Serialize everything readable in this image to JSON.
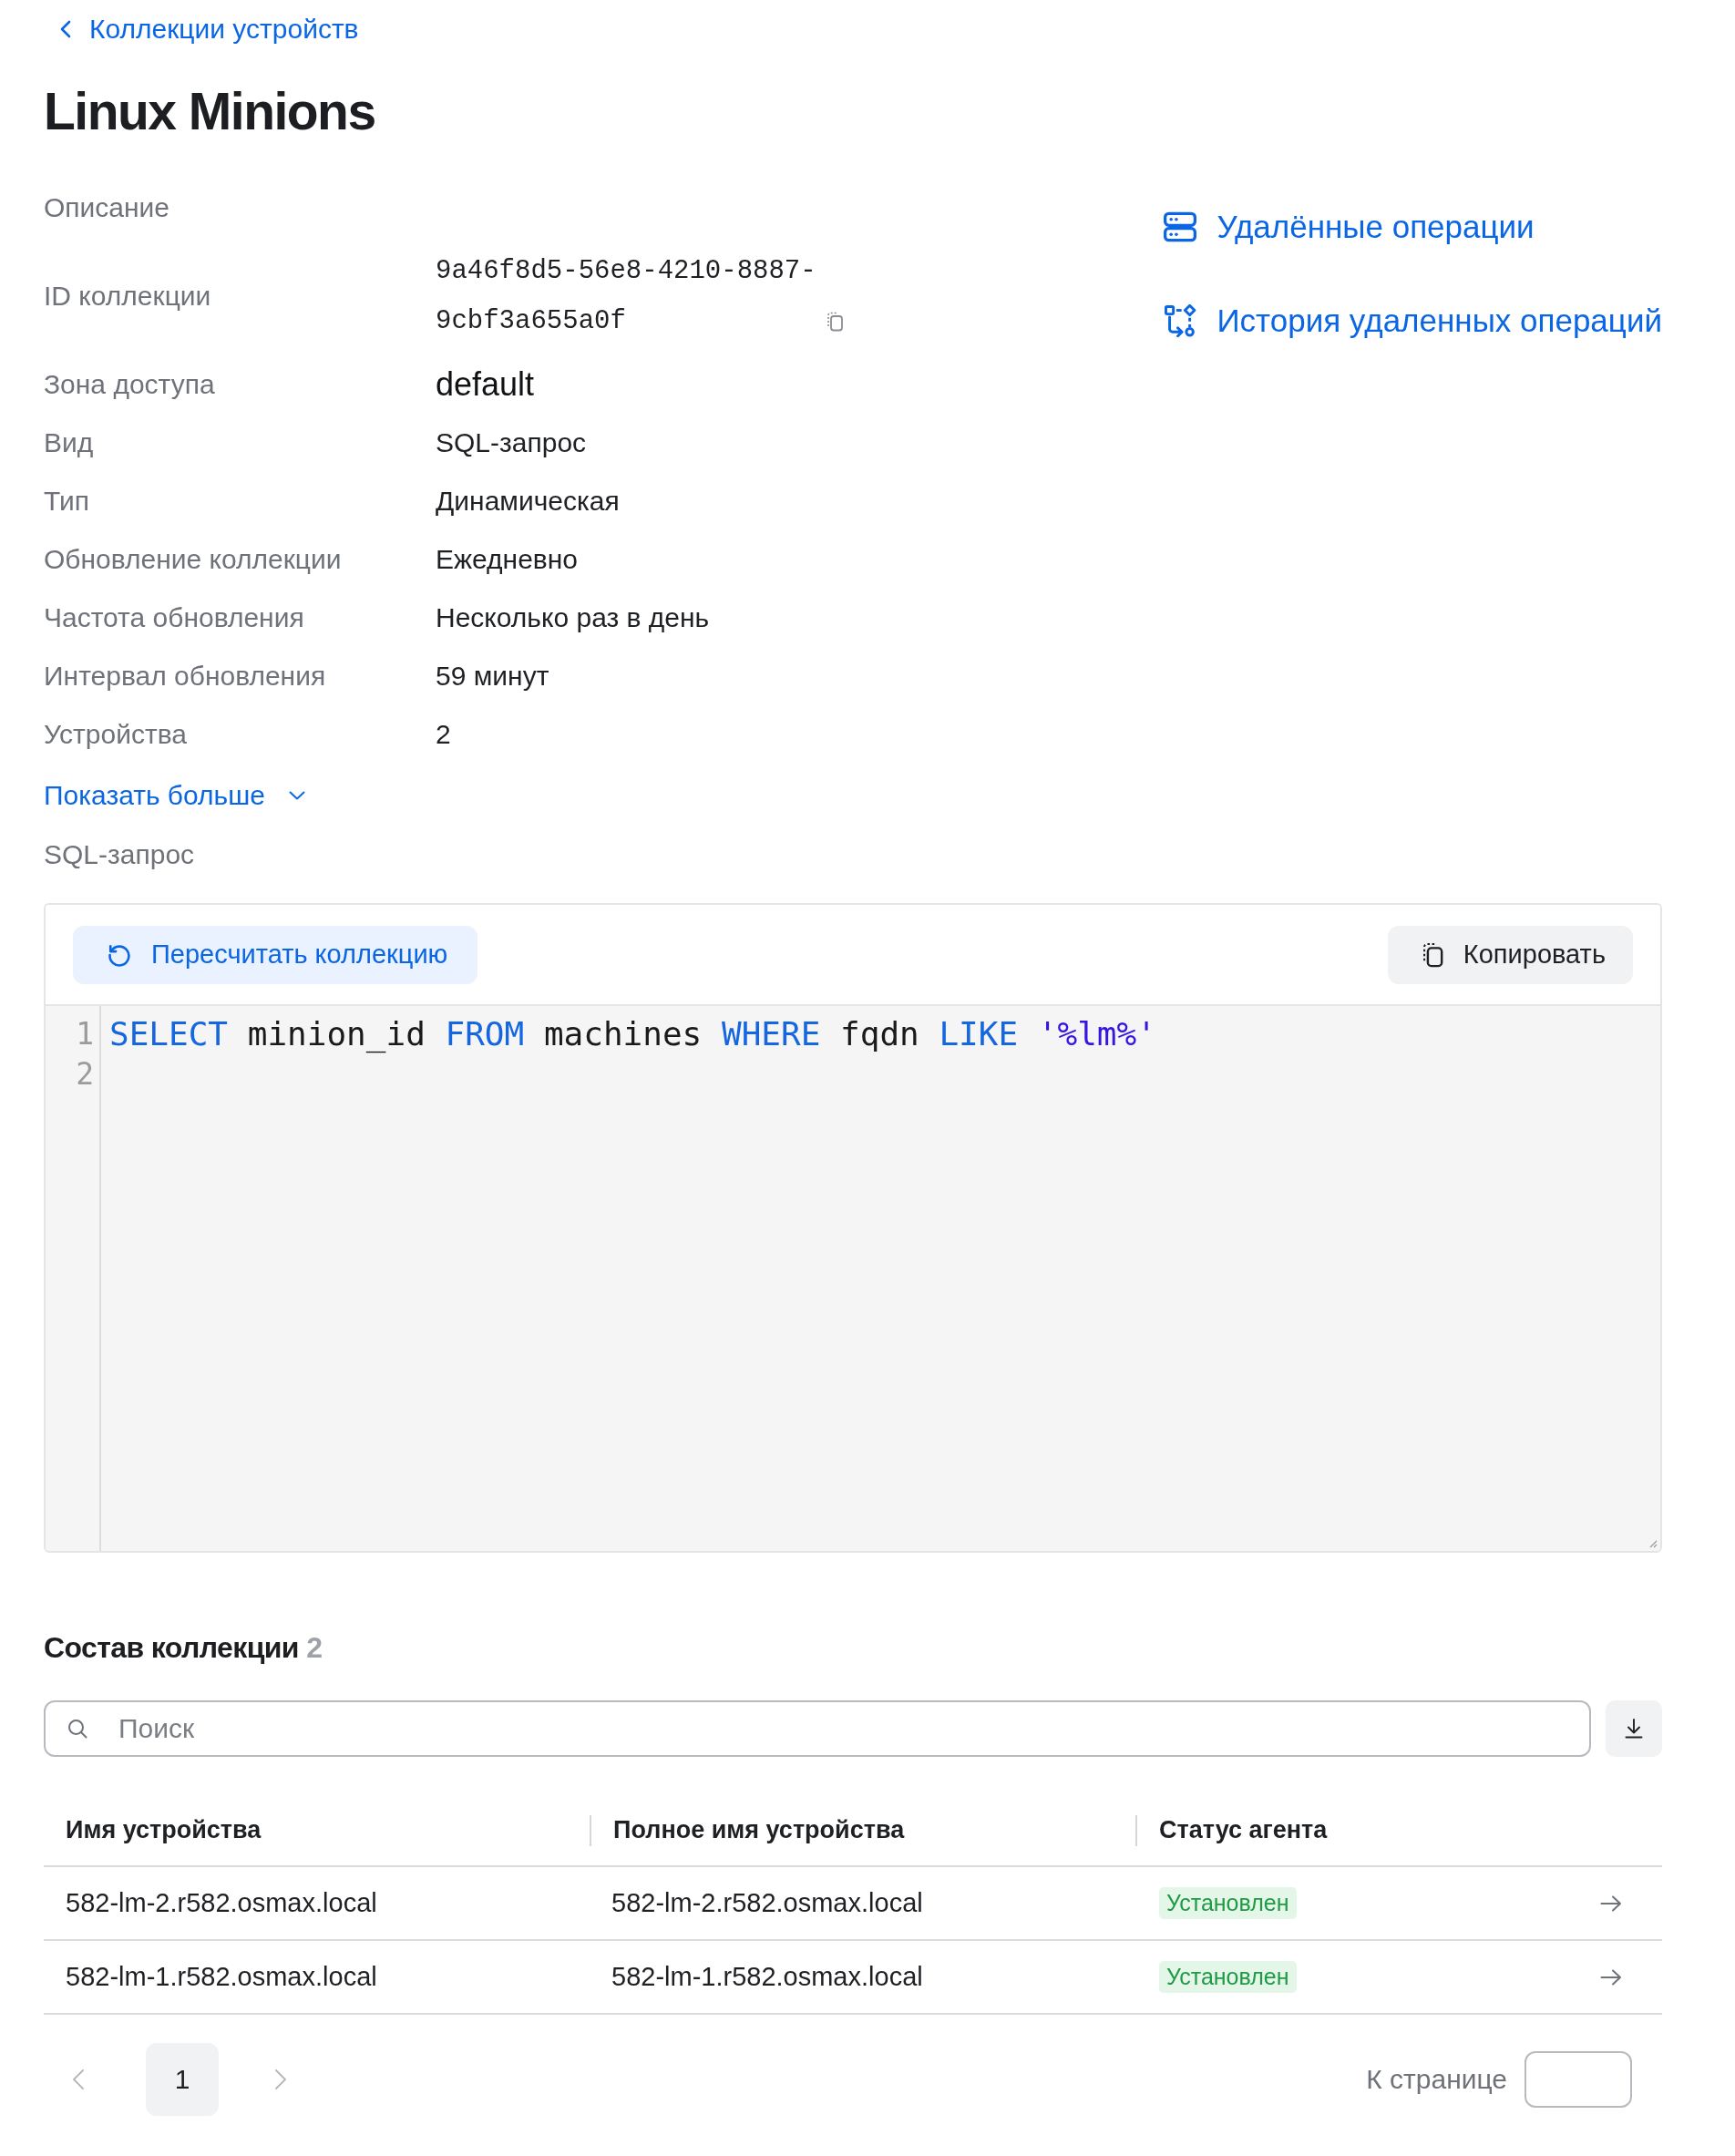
{
  "back_link": {
    "label": "Коллекции устройств"
  },
  "title": "Linux Minions",
  "details": [
    {
      "label": "Описание",
      "kind": "empty"
    },
    {
      "label": "ID коллекции",
      "value": "9a46f8d5-56e8-4210-8887-9cbf3a655a0f",
      "kind": "copyable"
    },
    {
      "label": "Зона доступа",
      "value": "default",
      "kind": "prominent"
    },
    {
      "label": "Вид",
      "value": "SQL-запрос",
      "kind": "text"
    },
    {
      "label": "Тип",
      "value": "Динамическая",
      "kind": "text"
    },
    {
      "label": "Обновление коллекции",
      "value": "Ежедневно",
      "kind": "text"
    },
    {
      "label": "Частота обновления",
      "value": "Несколько раз в день",
      "kind": "text"
    },
    {
      "label": "Интервал обновления",
      "value": "59 минут",
      "kind": "text"
    },
    {
      "label": "Устройства",
      "value": "2",
      "kind": "text"
    }
  ],
  "show_more": {
    "label": "Показать больше",
    "expanded": false
  },
  "query_label": "SQL-запрос",
  "side_links": [
    {
      "label": "Удалённые операции"
    },
    {
      "label": "История удаленных операций"
    }
  ],
  "editor": {
    "recalculate_button": "Пересчитать коллекцию",
    "copy_button": "Копировать",
    "lines": [
      {
        "number": "1",
        "tokens": [
          {
            "text": "SELECT",
            "kind": "keyword"
          },
          {
            "text": "minion_id",
            "kind": "identifier"
          },
          {
            "text": "FROM",
            "kind": "keyword"
          },
          {
            "text": "machines",
            "kind": "identifier"
          },
          {
            "text": "WHERE",
            "kind": "keyword"
          },
          {
            "text": "fqdn",
            "kind": "identifier"
          },
          {
            "text": "LIKE",
            "kind": "keyword"
          },
          {
            "text": "'%lm%'",
            "kind": "string"
          }
        ]
      },
      {
        "number": "2"
      }
    ]
  },
  "members": {
    "title": "Состав коллекции",
    "count": "2",
    "search": {
      "placeholder": "Поиск"
    },
    "columns": [
      "Имя устройства",
      "Полное имя устройства",
      "Статус агента"
    ],
    "rows": [
      {
        "device_name": "582-lm-2.r582.osmax.local",
        "full_name": "582-lm-2.r582.osmax.local",
        "agent_status": "Установлен"
      },
      {
        "device_name": "582-lm-1.r582.osmax.local",
        "full_name": "582-lm-1.r582.osmax.local",
        "agent_status": "Установлен"
      }
    ]
  },
  "pagination": {
    "previous": {
      "disabled": true
    },
    "pages": [
      {
        "label": "1",
        "selected": true
      }
    ],
    "next": {
      "disabled": true
    },
    "goto_label": "К странице"
  }
}
